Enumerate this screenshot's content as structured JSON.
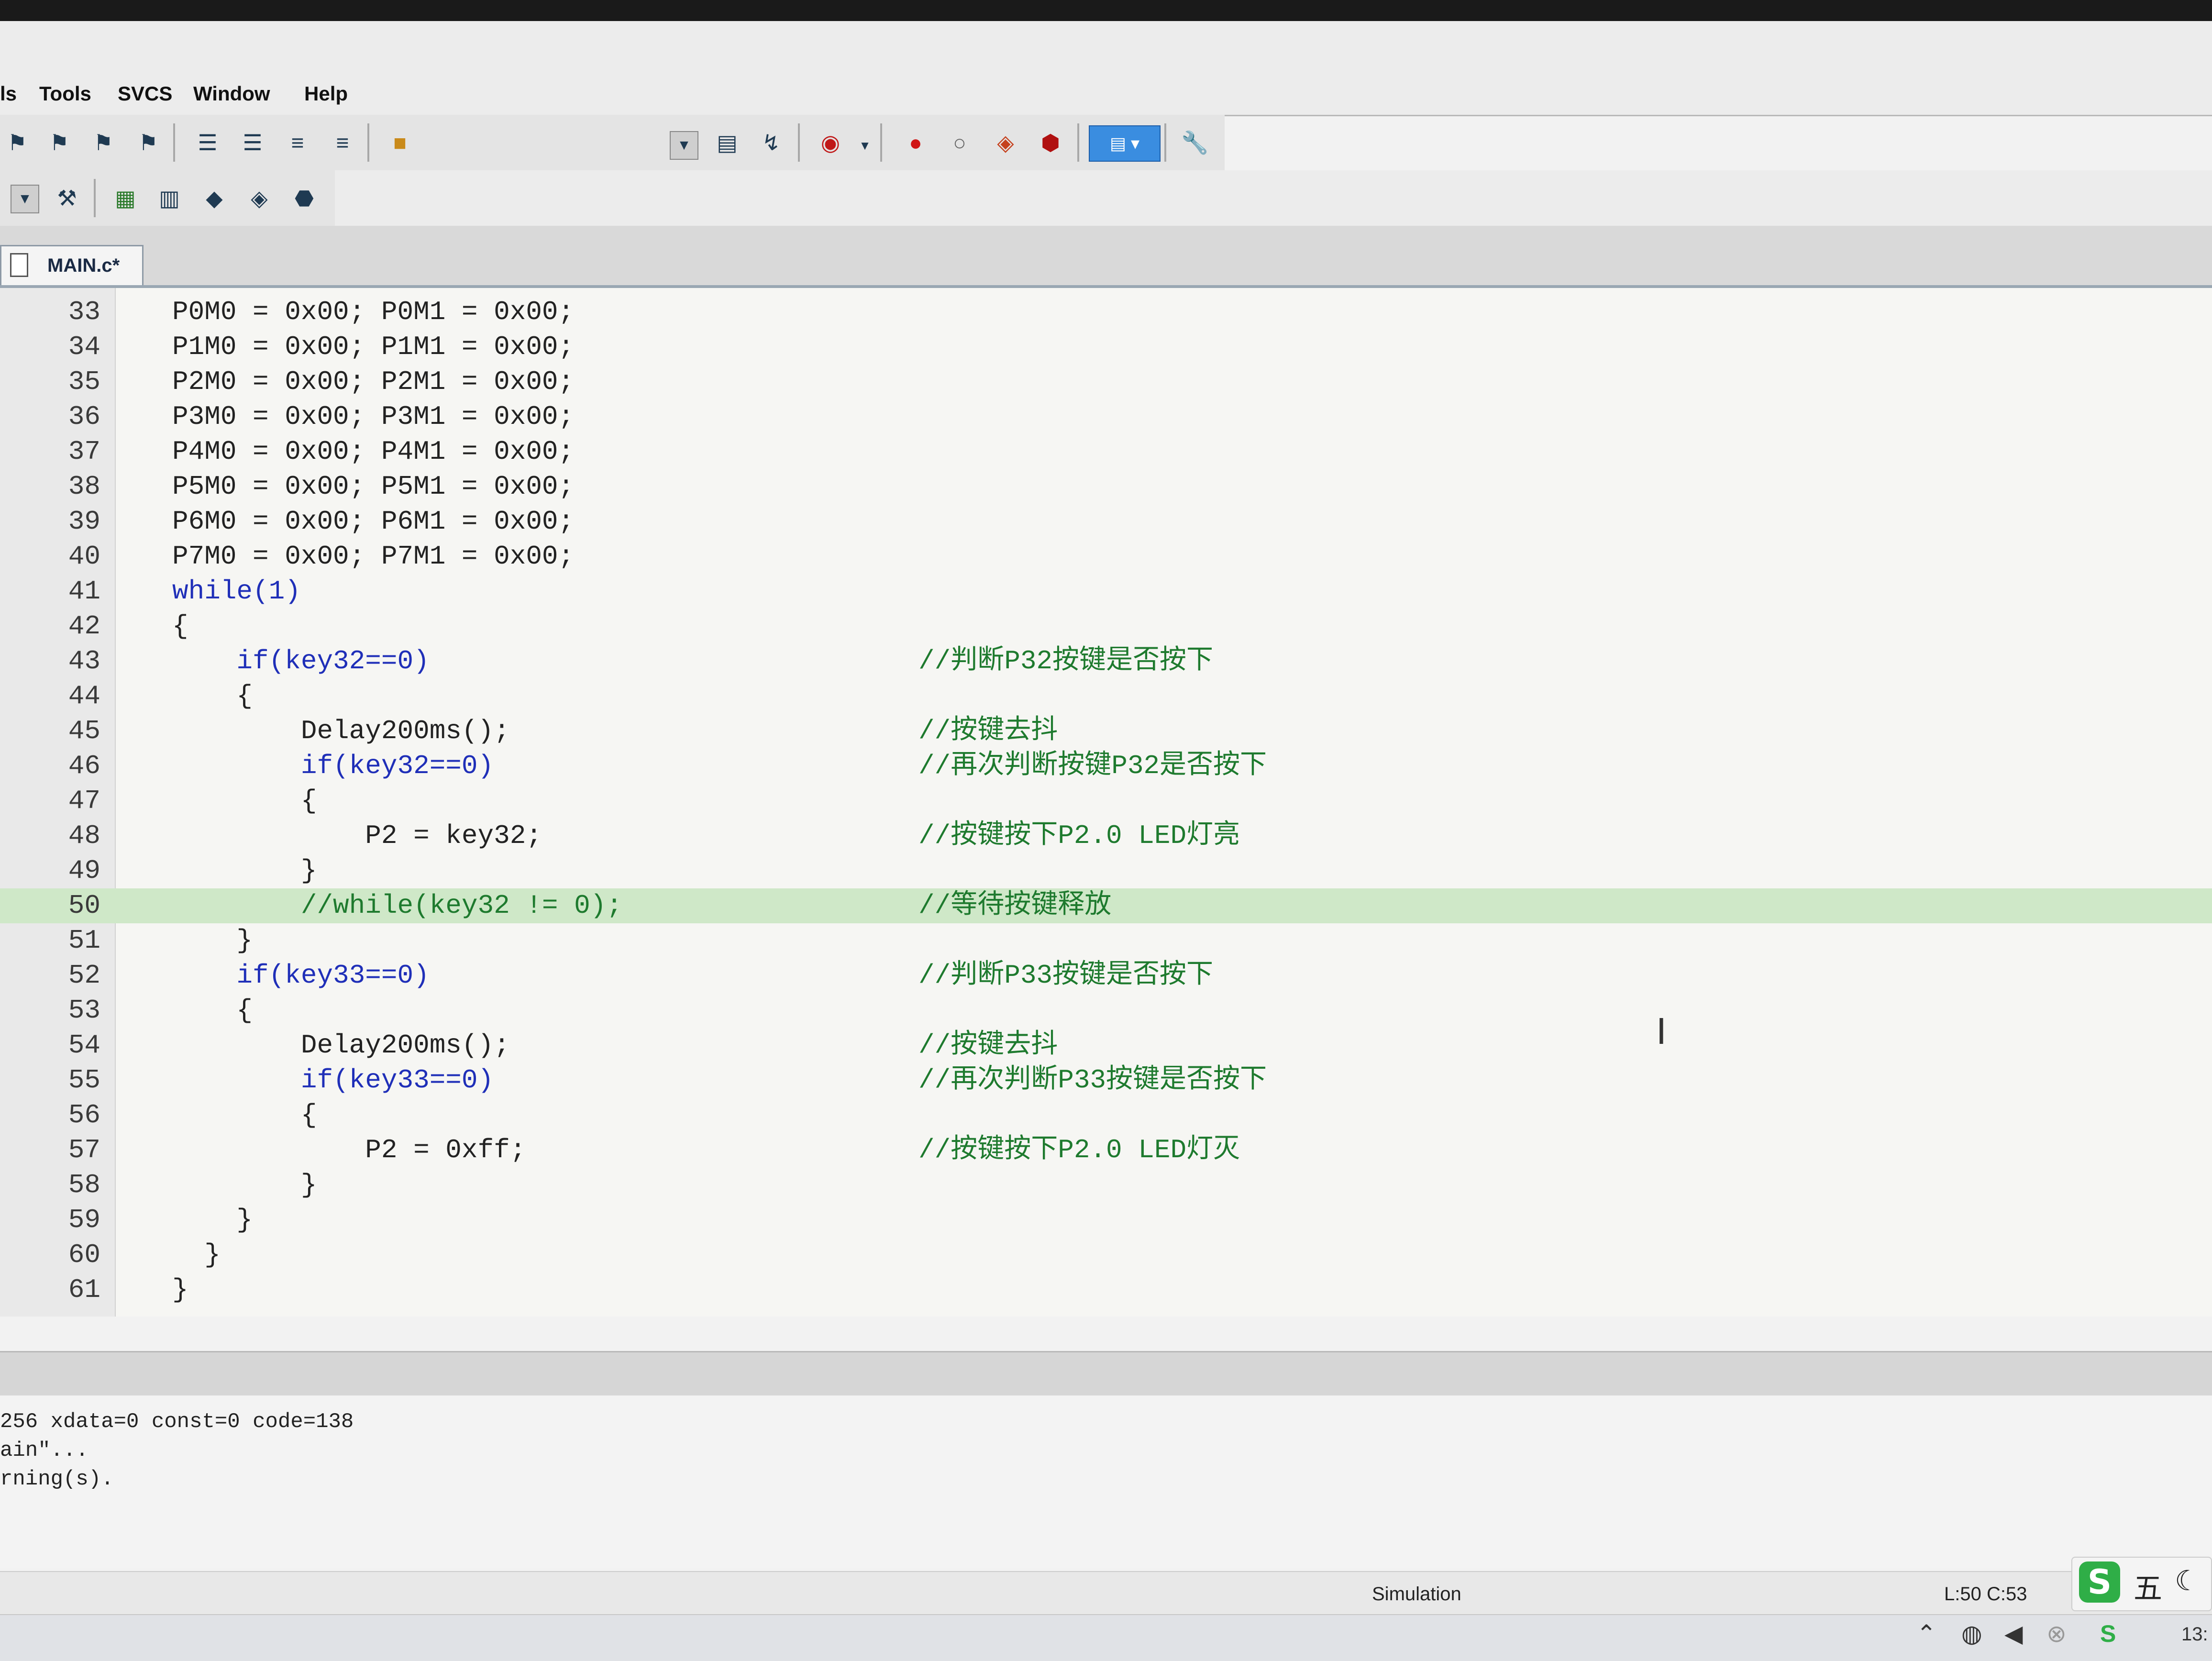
{
  "menu": {
    "items": [
      "ls",
      "Tools",
      "SVCS",
      "Window",
      "Help"
    ]
  },
  "toolbar1": {
    "icons": [
      "bookmark-icon",
      "bookmark-prev-icon",
      "bookmark-next-icon",
      "bookmark-clear-icon",
      "indent-icon",
      "outdent-icon",
      "comment-icon",
      "uncomment-icon",
      "open-folder-icon",
      "dropdown-icon",
      "find-in-files-icon",
      "incremental-find-icon",
      "debug-start-icon",
      "breakpoint-insert-icon",
      "breakpoint-disable-icon",
      "breakpoint-disable-all-icon",
      "breakpoint-kill-all-icon",
      "window-layout-icon",
      "configure-icon"
    ]
  },
  "toolbar2": {
    "icons": [
      "target-select-dropdown-icon",
      "target-options-icon",
      "manage-components-icon",
      "file-extensions-icon",
      "pack-installer-icon",
      "select-software-packs-icon",
      "rte-icon"
    ]
  },
  "tab": {
    "label": "MAIN.c*"
  },
  "editor": {
    "highlight_line": 50,
    "lines": [
      {
        "no": "33",
        "code": "P0M0 = 0x00; P0M1 = 0x00;",
        "comment": ""
      },
      {
        "no": "34",
        "code": "P1M0 = 0x00; P1M1 = 0x00;",
        "comment": ""
      },
      {
        "no": "35",
        "code": "P2M0 = 0x00; P2M1 = 0x00;",
        "comment": ""
      },
      {
        "no": "36",
        "code": "P3M0 = 0x00; P3M1 = 0x00;",
        "comment": ""
      },
      {
        "no": "37",
        "code": "P4M0 = 0x00; P4M1 = 0x00;",
        "comment": ""
      },
      {
        "no": "38",
        "code": "P5M0 = 0x00; P5M1 = 0x00;",
        "comment": ""
      },
      {
        "no": "39",
        "code": "P6M0 = 0x00; P6M1 = 0x00;",
        "comment": ""
      },
      {
        "no": "40",
        "code": "P7M0 = 0x00; P7M1 = 0x00;",
        "comment": ""
      },
      {
        "no": "41",
        "code": "while(1)",
        "comment": ""
      },
      {
        "no": "42",
        "code": "{",
        "comment": ""
      },
      {
        "no": "43",
        "code": "    if(key32==0)",
        "comment": "//判断P32按键是否按下"
      },
      {
        "no": "44",
        "code": "    {",
        "comment": ""
      },
      {
        "no": "45",
        "code": "        Delay200ms();",
        "comment": "//按键去抖"
      },
      {
        "no": "46",
        "code": "        if(key32==0)",
        "comment": "//再次判断按键P32是否按下"
      },
      {
        "no": "47",
        "code": "        {",
        "comment": ""
      },
      {
        "no": "48",
        "code": "            P2 = key32;",
        "comment": "//按键按下P2.0 LED灯亮"
      },
      {
        "no": "49",
        "code": "        }",
        "comment": ""
      },
      {
        "no": "50",
        "code": "        //while(key32 != 0);",
        "comment": "//等待按键释放"
      },
      {
        "no": "51",
        "code": "    }",
        "comment": ""
      },
      {
        "no": "52",
        "code": "    if(key33==0)",
        "comment": "//判断P33按键是否按下"
      },
      {
        "no": "53",
        "code": "    {",
        "comment": ""
      },
      {
        "no": "54",
        "code": "        Delay200ms();",
        "comment": "//按键去抖"
      },
      {
        "no": "55",
        "code": "        if(key33==0)",
        "comment": "//再次判断P33按键是否按下"
      },
      {
        "no": "56",
        "code": "        {",
        "comment": ""
      },
      {
        "no": "57",
        "code": "            P2 = 0xff;",
        "comment": "//按键按下P2.0 LED灯灭"
      },
      {
        "no": "58",
        "code": "        }",
        "comment": ""
      },
      {
        "no": "59",
        "code": "    }",
        "comment": ""
      },
      {
        "no": "60",
        "code": "  }",
        "comment": ""
      },
      {
        "no": "61",
        "code": "}",
        "comment": ""
      }
    ]
  },
  "build_output": {
    "lines": [
      "256 xdata=0 const=0 code=138",
      "ain\"...",
      "rning(s)."
    ]
  },
  "status": {
    "mode": "Simulation",
    "cursor": "L:50 C:53"
  },
  "ime": {
    "logo": "S",
    "mode": "五"
  },
  "taskbar": {
    "clock_partial": "13:"
  }
}
